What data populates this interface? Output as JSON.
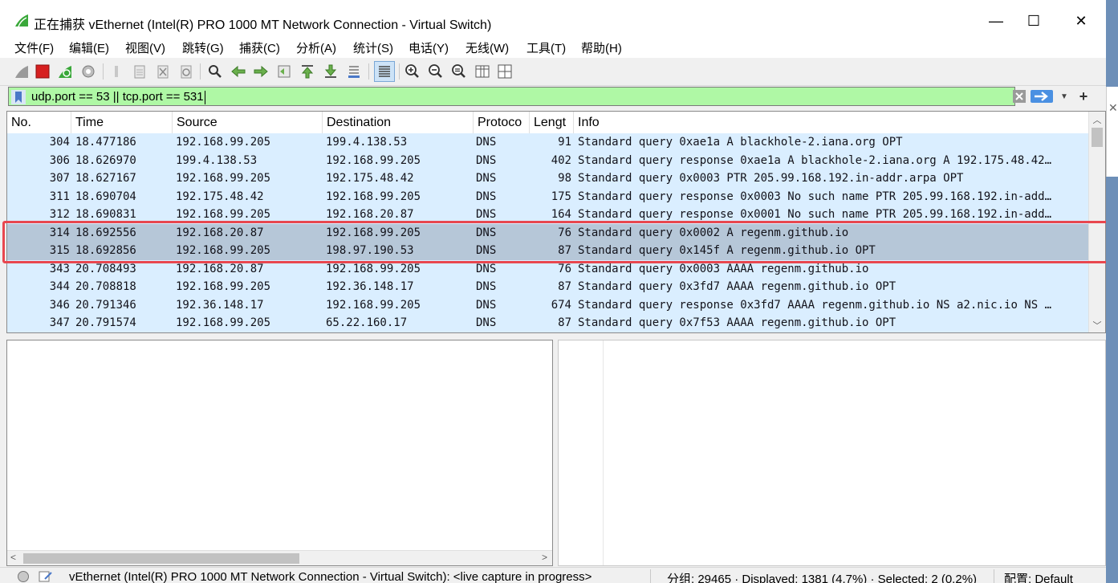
{
  "window": {
    "title": "正在捕获 vEthernet (Intel(R) PRO 1000 MT Network Connection - Virtual Switch)",
    "minimize": "—",
    "maximize": "☐",
    "close": "✕"
  },
  "menu": [
    {
      "label": "文件(F)"
    },
    {
      "label": "编辑(E)"
    },
    {
      "label": "视图(V)"
    },
    {
      "label": "跳转(G)"
    },
    {
      "label": "捕获(C)"
    },
    {
      "label": "分析(A)"
    },
    {
      "label": "统计(S)"
    },
    {
      "label": "电话(Y)"
    },
    {
      "label": "无线(W)"
    },
    {
      "label": "工具(T)"
    },
    {
      "label": "帮助(H)"
    }
  ],
  "toolbar": {
    "icons": [
      "shark-fin-start-icon",
      "stop-capture-icon",
      "restart-capture-icon",
      "capture-options-icon",
      "open-file-icon",
      "save-file-icon",
      "close-file-icon",
      "reload-file-icon",
      "find-packet-icon",
      "go-back-icon",
      "go-forward-icon",
      "go-to-packet-icon",
      "first-packet-icon",
      "last-packet-icon",
      "autoscroll-icon",
      "colorize-icon",
      "zoom-in-icon",
      "zoom-out-icon",
      "zoom-normal-icon",
      "resize-columns-icon",
      "layout-icon"
    ]
  },
  "filter": {
    "value": "udp.port == 53 || tcp.port == 531",
    "add_label": "+"
  },
  "columns": {
    "no": "No.",
    "time": "Time",
    "source": "Source",
    "destination": "Destination",
    "protocol": "Protoco",
    "length": "Lengt",
    "info": "Info"
  },
  "packets": [
    {
      "no": "304",
      "time": "18.477186",
      "src": "192.168.99.205",
      "dst": "199.4.138.53",
      "proto": "DNS",
      "len": "91",
      "info": "Standard query 0xae1a A blackhole-2.iana.org OPT",
      "selected": false
    },
    {
      "no": "306",
      "time": "18.626970",
      "src": "199.4.138.53",
      "dst": "192.168.99.205",
      "proto": "DNS",
      "len": "402",
      "info": "Standard query response 0xae1a A blackhole-2.iana.org A 192.175.48.42…",
      "selected": false
    },
    {
      "no": "307",
      "time": "18.627167",
      "src": "192.168.99.205",
      "dst": "192.175.48.42",
      "proto": "DNS",
      "len": "98",
      "info": "Standard query 0x0003 PTR 205.99.168.192.in-addr.arpa OPT",
      "selected": false
    },
    {
      "no": "311",
      "time": "18.690704",
      "src": "192.175.48.42",
      "dst": "192.168.99.205",
      "proto": "DNS",
      "len": "175",
      "info": "Standard query response 0x0003 No such name PTR 205.99.168.192.in-add…",
      "selected": false
    },
    {
      "no": "312",
      "time": "18.690831",
      "src": "192.168.99.205",
      "dst": "192.168.20.87",
      "proto": "DNS",
      "len": "164",
      "info": "Standard query response 0x0001 No such name PTR 205.99.168.192.in-add…",
      "selected": false
    },
    {
      "no": "314",
      "time": "18.692556",
      "src": "192.168.20.87",
      "dst": "192.168.99.205",
      "proto": "DNS",
      "len": "76",
      "info": "Standard query 0x0002 A regenm.github.io",
      "selected": true
    },
    {
      "no": "315",
      "time": "18.692856",
      "src": "192.168.99.205",
      "dst": "198.97.190.53",
      "proto": "DNS",
      "len": "87",
      "info": "Standard query 0x145f A regenm.github.io OPT",
      "selected": true
    },
    {
      "no": "343",
      "time": "20.708493",
      "src": "192.168.20.87",
      "dst": "192.168.99.205",
      "proto": "DNS",
      "len": "76",
      "info": "Standard query 0x0003 AAAA regenm.github.io",
      "selected": false
    },
    {
      "no": "344",
      "time": "20.708818",
      "src": "192.168.99.205",
      "dst": "192.36.148.17",
      "proto": "DNS",
      "len": "87",
      "info": "Standard query 0x3fd7 AAAA regenm.github.io OPT",
      "selected": false
    },
    {
      "no": "346",
      "time": "20.791346",
      "src": "192.36.148.17",
      "dst": "192.168.99.205",
      "proto": "DNS",
      "len": "674",
      "info": "Standard query response 0x3fd7 AAAA regenm.github.io NS a2.nic.io NS …",
      "selected": false
    },
    {
      "no": "347",
      "time": "20.791574",
      "src": "192.168.99.205",
      "dst": "65.22.160.17",
      "proto": "DNS",
      "len": "87",
      "info": "Standard query 0x7f53 AAAA regenm.github.io OPT",
      "selected": false
    }
  ],
  "status": {
    "interface": "vEthernet (Intel(R) PRO 1000 MT Network Connection - Virtual Switch): <live capture in progress>",
    "counts": "分组: 29465 · Displayed: 1381 (4.7%) · Selected: 2 (0.2%)",
    "profile": "配置: Default"
  },
  "colors": {
    "filter_ok": "#aff8a5",
    "row_bg": "#daeeff",
    "row_selected": "#b6c7d8",
    "highlight": "#e8474f"
  }
}
